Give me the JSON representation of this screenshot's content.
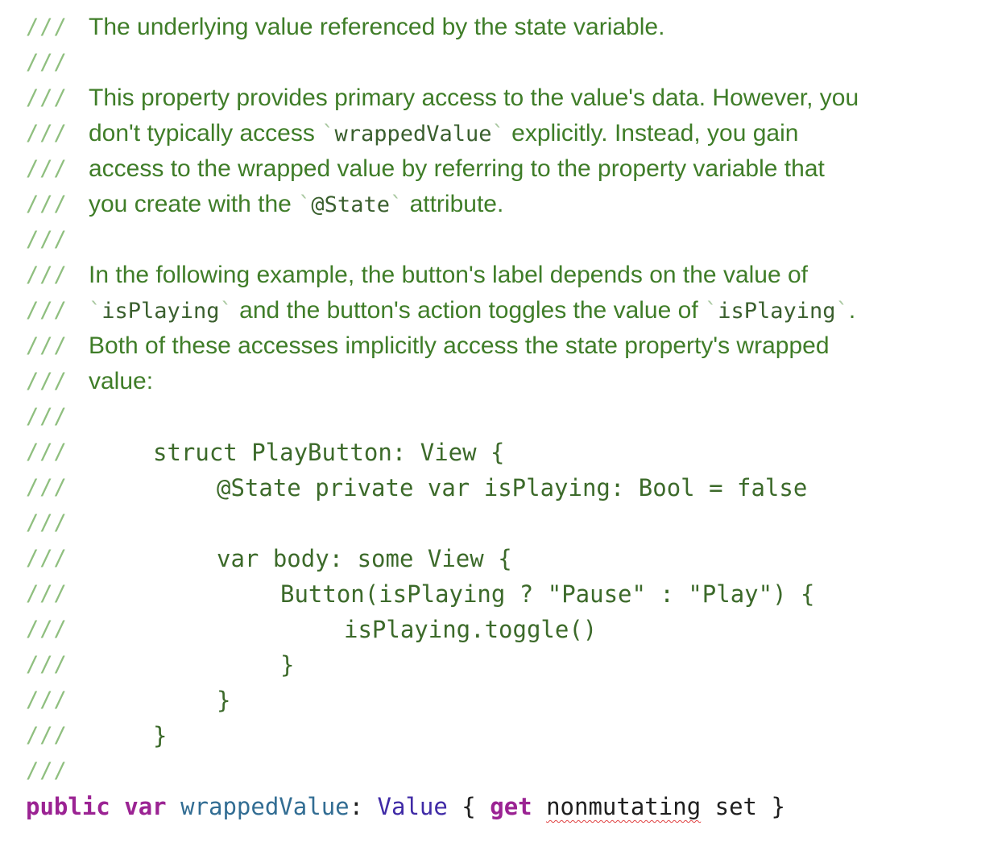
{
  "comment_prefix": "///",
  "doc": {
    "summary": "The underlying value referenced by the state variable.",
    "p1_l1": "This property provides primary access to the value's data. However, you",
    "p1_l2_a": "don't typically access ",
    "p1_l2_code": "wrappedValue",
    "p1_l2_b": " explicitly. Instead, you gain",
    "p1_l3": "access to the wrapped value by referring to the property variable that",
    "p1_l4_a": "you create with the ",
    "p1_l4_code": "@State",
    "p1_l4_b": " attribute.",
    "p2_l1": "In the following example, the button's label depends on the value of",
    "p2_l2_code1": "isPlaying",
    "p2_l2_mid": " and the button's action toggles the value of ",
    "p2_l2_code2": "isPlaying",
    "p2_l2_end": ".",
    "p2_l3": "Both of these accesses implicitly access the state property's wrapped",
    "p2_l4": "value:",
    "tick": "`"
  },
  "example_code": {
    "l1": "struct PlayButton: View {",
    "l2": "@State private var isPlaying: Bool = false",
    "l3": "var body: some View {",
    "l4": "Button(isPlaying ? \"Pause\" : \"Play\") {",
    "l5": "isPlaying.toggle()",
    "l6": "}",
    "l7": "}",
    "l8": "}"
  },
  "declaration": {
    "public": "public",
    "var": "var",
    "name": "wrappedValue",
    "colon": ": ",
    "type": "Value",
    "open": " { ",
    "get": "get",
    "nonmutating": "nonmutating",
    "set": " set }"
  },
  "colors": {
    "comment_text": "#3f7d28",
    "comment_prefix": "#8fbf7f",
    "keyword": "#9b2393",
    "identifier": "#326d93",
    "type": "#3f2aa6"
  }
}
